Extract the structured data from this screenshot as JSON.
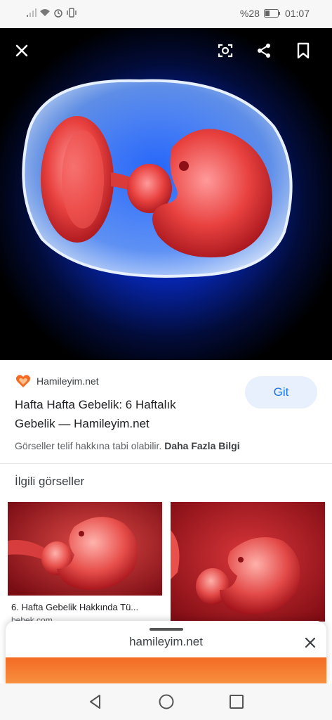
{
  "status": {
    "battery_percent": "%28",
    "time": "01:07"
  },
  "source": {
    "name": "Hamileyim.net"
  },
  "result": {
    "title_line1": "Hafta Hafta Gebelik: 6 Haftalık",
    "title_line2": "Gebelik — Hamileyim.net",
    "visit_label": "Git",
    "copyright_text": "Görseller telif hakkına tabi olabilir.",
    "more_info_label": "Daha Fazla Bilgi"
  },
  "related": {
    "heading": "İlgili görseller",
    "items": [
      {
        "caption": "6. Hafta Gebelik Hakkında Tü...",
        "site": "bebek.com"
      }
    ]
  },
  "sheet": {
    "url": "hamileyim.net"
  },
  "colors": {
    "accent": "#1a73e8",
    "button_bg": "#e8f0fe",
    "brand_orange": "#f36b24"
  }
}
